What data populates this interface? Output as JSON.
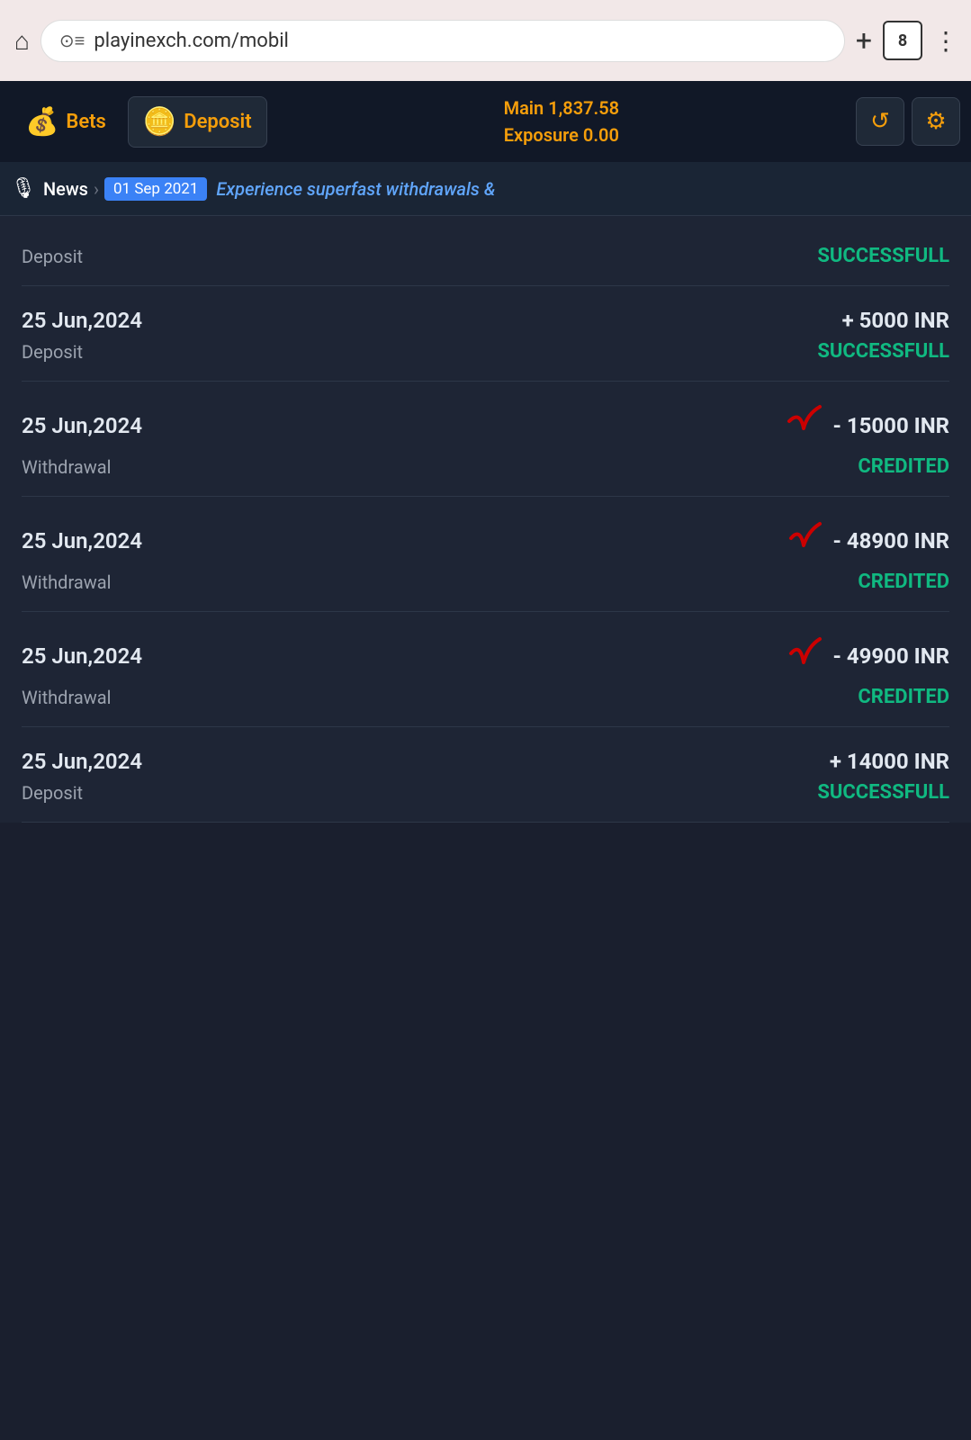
{
  "browser": {
    "url": "playinexch.com/mobil",
    "tabs_count": "8",
    "home_icon": "⌂",
    "add_icon": "+",
    "menu_icon": "⋮"
  },
  "header": {
    "bets_label": "Bets",
    "deposit_label": "Deposit",
    "balance_main_label": "Main",
    "balance_main_value": "1,837.58",
    "balance_exposure_label": "Exposure",
    "balance_exposure_value": "0.00",
    "refresh_icon": "↺",
    "settings_icon": "⚙"
  },
  "news": {
    "label": "News",
    "date": "01 Sep 2021",
    "text": "Experience superfast withdrawals &"
  },
  "transactions": [
    {
      "date": "",
      "amount": "",
      "type": "Deposit",
      "status": "SUCCESSFULL",
      "status_class": "status-success",
      "has_check": false
    },
    {
      "date": "25 Jun,2024",
      "amount": "+ 5000 INR",
      "type": "Deposit",
      "status": "SUCCESSFULL",
      "status_class": "status-success",
      "has_check": false
    },
    {
      "date": "25 Jun,2024",
      "amount": "- 15000 INR",
      "type": "Withdrawal",
      "status": "CREDITED",
      "status_class": "status-credited",
      "has_check": true
    },
    {
      "date": "25 Jun,2024",
      "amount": "- 48900 INR",
      "type": "Withdrawal",
      "status": "CREDITED",
      "status_class": "status-credited",
      "has_check": true
    },
    {
      "date": "25 Jun,2024",
      "amount": "- 49900 INR",
      "type": "Withdrawal",
      "status": "CREDITED",
      "status_class": "status-credited",
      "has_check": true
    },
    {
      "date": "25 Jun,2024",
      "amount": "+ 14000 INR",
      "type": "Deposit",
      "status": "SUCCESSFULL",
      "status_class": "status-success",
      "has_check": false
    }
  ]
}
